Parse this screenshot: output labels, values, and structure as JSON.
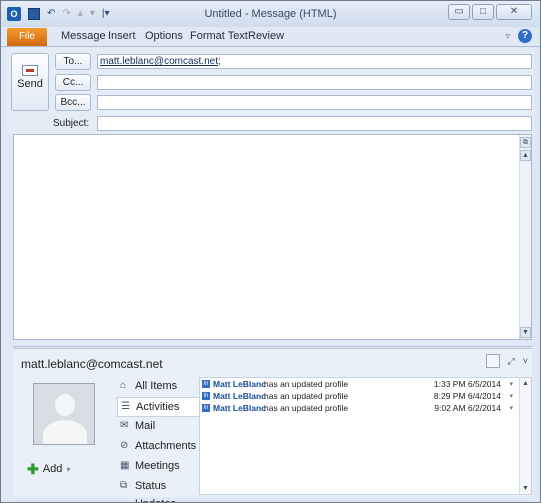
{
  "window": {
    "title": "Untitled - Message (HTML)",
    "minimize_glyph": "▭",
    "maximize_glyph": "□",
    "close_glyph": "✕"
  },
  "qat": {
    "app_glyph": "O",
    "undo_glyph": "↶",
    "redo_glyph": "↷",
    "up_glyph": "▴",
    "down_glyph": "▾",
    "customize_glyph": "|▾"
  },
  "ribbon": {
    "tabs": [
      "File",
      "Message",
      "Insert",
      "Options",
      "Format Text",
      "Review"
    ],
    "collapse_glyph": "▿",
    "help_glyph": "?"
  },
  "compose": {
    "send_label": "Send",
    "to_label": "To...",
    "cc_label": "Cc...",
    "bcc_label": "Bcc...",
    "subject_label": "Subject:",
    "to_value": "matt.leblanc@comcast.net",
    "to_separator": ";",
    "cc_value": "",
    "bcc_value": "",
    "subject_value": ""
  },
  "scroll": {
    "top_glyph": "⧉",
    "up_glyph": "▲",
    "down_glyph": "▼"
  },
  "people_pane": {
    "contact_email": "matt.leblanc@comcast.net",
    "expand_glyph": "⤢",
    "collapse_glyph": "˅",
    "add_label": "Add",
    "add_glyph": "✚",
    "add_dropdown_glyph": "▾",
    "nav": [
      {
        "label": "All Items",
        "icon": "home-icon",
        "glyph": "⌂",
        "selected": false
      },
      {
        "label": "Activities",
        "icon": "activities-icon",
        "glyph": "☰",
        "selected": true
      },
      {
        "label": "Mail",
        "icon": "mail-icon",
        "glyph": "✉",
        "selected": false
      },
      {
        "label": "Attachments",
        "icon": "paperclip-icon",
        "glyph": "⊘",
        "selected": false
      },
      {
        "label": "Meetings",
        "icon": "calendar-icon",
        "glyph": "▦",
        "selected": false
      },
      {
        "label": "Status Updates",
        "icon": "status-icon",
        "glyph": "⧉",
        "selected": false
      }
    ],
    "activities": [
      {
        "name": "Matt LeBlanc",
        "text": "has an updated profile",
        "time": "1:33 PM 6/5/2014"
      },
      {
        "name": "Matt LeBlanc",
        "text": "has an updated profile",
        "time": "8:29 PM 6/4/2014"
      },
      {
        "name": "Matt LeBlanc",
        "text": "has an updated profile",
        "time": "9:02 AM 6/2/2014"
      }
    ],
    "row_icon_glyph": "in",
    "row_dropdown_glyph": "▾",
    "list_up_glyph": "▲",
    "list_down_glyph": "▼"
  },
  "colors": {
    "file_tab": "#e07a1a",
    "link_blue": "#1d4d9c",
    "window_chrome": "#dfe8f4"
  }
}
